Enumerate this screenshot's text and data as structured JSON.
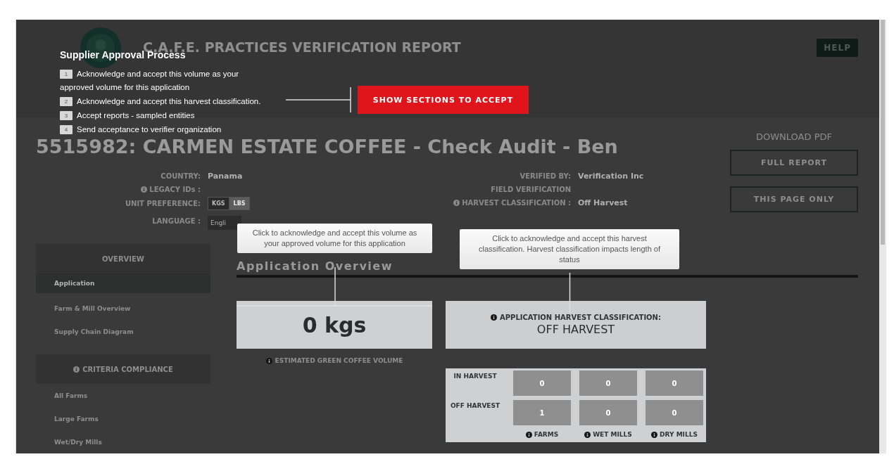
{
  "header": {
    "title": "C.A.F.E. PRACTICES VERIFICATION REPORT",
    "help_button": "HELP"
  },
  "tour": {
    "title": "Supplier Approval Process",
    "action_button": "SHOW SECTIONS TO ACCEPT",
    "steps": [
      {
        "number": "1",
        "text": "Acknowledge and accept this volume as your approved volume for this application"
      },
      {
        "number": "2",
        "text": "Acknowledge and accept this harvest classification."
      },
      {
        "number": "3",
        "text": "Accept reports - sampled entities"
      },
      {
        "number": "4",
        "text": "Send acceptance to verifier organization"
      }
    ]
  },
  "report": {
    "title": "5515982: CARMEN ESTATE COFFEE - Check Audit - Ben",
    "download_label": "DOWNLOAD PDF",
    "download_buttons": [
      "FULL REPORT",
      "THIS PAGE ONLY"
    ]
  },
  "details_left": [
    {
      "kind": "text",
      "label": "COUNTRY:",
      "value": "Panama",
      "info": false
    },
    {
      "kind": "text",
      "label": "LEGACY IDs :",
      "info": true
    },
    {
      "kind": "toggle",
      "label": "UNIT PREFERENCE:",
      "info": false,
      "options": [
        {
          "label": "KGS",
          "selected": true
        },
        {
          "label": "LBS",
          "selected": false
        }
      ]
    },
    {
      "kind": "select",
      "label": "LANGUAGE :",
      "value": "Engli",
      "info": false
    }
  ],
  "details_right": [
    {
      "kind": "text",
      "label": "VERIFIED BY:",
      "value": "Verification Inc",
      "info": false
    },
    {
      "kind": "text",
      "label": "FIELD VERIFICATION",
      "info": false
    },
    {
      "kind": "text",
      "label": "HARVEST CLASSIFICATION :",
      "value": "Off Harvest",
      "info": true
    }
  ],
  "sidebar": {
    "sections": [
      {
        "title": "OVERVIEW",
        "info": false,
        "items": [
          {
            "label": "Application",
            "selected": true
          },
          {
            "label": "Farm & Mill Overview",
            "selected": false
          },
          {
            "label": "Supply Chain Diagram",
            "selected": false
          }
        ]
      },
      {
        "title": "CRITERIA COMPLIANCE",
        "info": true,
        "items": [
          {
            "label": "All Farms",
            "selected": false
          },
          {
            "label": "Large Farms",
            "selected": false
          },
          {
            "label": "Wet/Dry Mills",
            "selected": false
          }
        ]
      }
    ]
  },
  "overview": {
    "heading": "Application Overview",
    "volume": {
      "value": "0 kgs",
      "caption": "ESTIMATED GREEN COFFEE VOLUME"
    },
    "harvest": {
      "label": "APPLICATION HARVEST CLASSIFICATION:",
      "value": "OFF HARVEST"
    },
    "table": {
      "rows": [
        {
          "label": "IN HARVEST",
          "cells": [
            "0",
            "0",
            "0"
          ]
        },
        {
          "label": "OFF HARVEST",
          "cells": [
            "1",
            "0",
            "0"
          ]
        }
      ],
      "footer_labels": [
        "FARMS",
        "WET MILLS",
        "DRY MILLS"
      ]
    }
  },
  "tooltips": [
    {
      "text": "Click to acknowledge and accept this volume as your approved volume for this application"
    },
    {
      "text": "Click to acknowledge and accept this harvest classification. Harvest classification impacts length of status"
    }
  ]
}
